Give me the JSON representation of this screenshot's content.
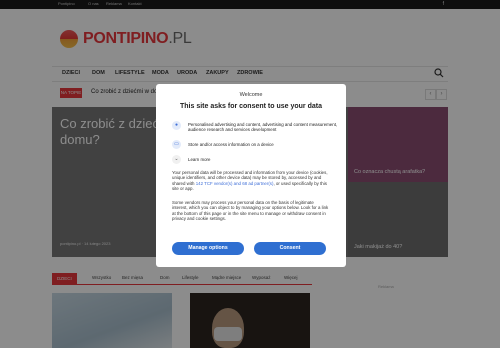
{
  "topbar": {
    "links": [
      "Pontipino",
      "O nas",
      "Reklama",
      "Kontakt"
    ],
    "social": "f"
  },
  "logo": {
    "brand": "PONTIPINO",
    "tld": ".PL"
  },
  "nav": {
    "items": [
      "DZIECI",
      "DOM",
      "LIFESTYLE",
      "MODA",
      "URODA",
      "ZAKUPY",
      "ZDROWIE"
    ],
    "search_icon": "search-icon"
  },
  "ticker": {
    "badge": "NA TOPIE",
    "text": "Co zrobić z dzieć­mi w do"
  },
  "hero": {
    "title": "Co zrobić z dzieć domu?",
    "meta": "pontipino.pl  ·  14 lutego 2023",
    "side_caption_1": "Co oznacza chustą arafatka?",
    "side_caption_2": "Jaki makijaż do 40?"
  },
  "tabs": [
    "DZIECI",
    "Wszystko",
    "Bez mięsa",
    "Dom",
    "Lifestyle",
    "Mądre miejsce",
    "Wyposaż",
    "Więcej"
  ],
  "sidebar_label": "Reklama",
  "consent": {
    "welcome": "Welcome",
    "heading": "This site asks for consent to use your data",
    "purposes": [
      {
        "icon": "person-icon",
        "text": "Personalised advertising and content, advertising and content measurement, audience research and services development"
      },
      {
        "icon": "device-icon",
        "text": "Store and/or access information on a device"
      },
      {
        "icon": "chevron-down-icon",
        "text": "Learn more"
      }
    ],
    "body_part1": "Your personal data will be processed and information from your device (cookies, unique identifiers, and other device data) may be stored by, accessed by and shared with",
    "body_link": "142 TCF vendor(s) and 68 ad partner(s)",
    "body_part2": ", or used specifically by this site or app.",
    "body2": "Some vendors may process your personal data on the basis of legitimate interest, which you can object to by managing your options below. Look for a link at the bottom of this page or in the site menu to manage or withdraw consent in privacy and cookie settings.",
    "manage_label": "Manage options",
    "consent_label": "Consent"
  },
  "colors": {
    "brand": "#e8383d",
    "button": "#2f6fd1",
    "link": "#3f6fd8"
  }
}
